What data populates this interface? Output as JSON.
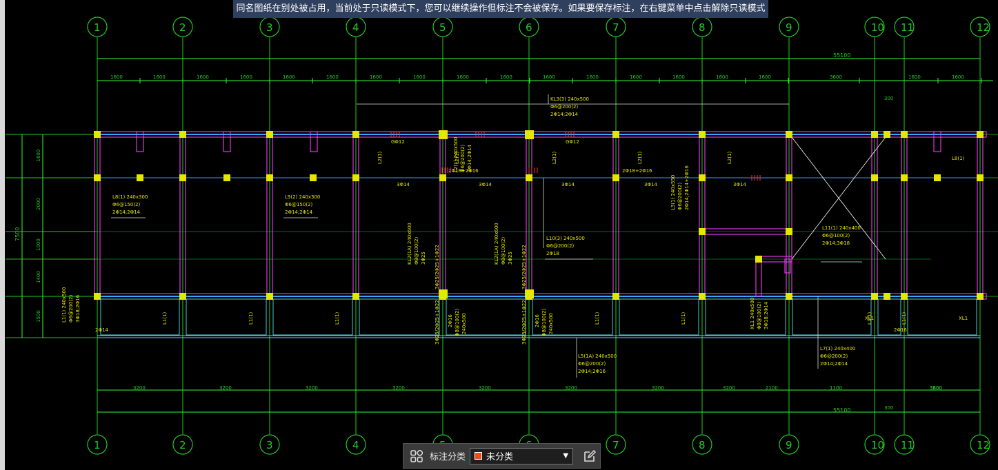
{
  "banner": {
    "text": "同名图纸在别处被占用，当前处于只读模式下，您可以继续操作但标注不会被保存。如果要保存标注，在右键菜单中点击解除只读模式"
  },
  "axes": {
    "labels": [
      "1",
      "2",
      "3",
      "4",
      "5",
      "6",
      "7",
      "8",
      "9",
      "10",
      "11",
      "12"
    ]
  },
  "dimensions": {
    "top_total": "55100",
    "top_segments": [
      "1600",
      "1600",
      "1600",
      "1600",
      "1600",
      "1600",
      "1600",
      "1600",
      "1600",
      "1600",
      "1600",
      "1600",
      "1600",
      "1600",
      "1600",
      "1600",
      "3600",
      "1600",
      "1600"
    ],
    "bottom_segments": [
      "3200",
      "3200",
      "3200",
      "3200",
      "3200",
      "3200",
      "3200",
      "3200",
      "2100",
      "1100",
      "3600",
      "3200"
    ],
    "bottom_total": "55100",
    "gap_top": "300",
    "gap_bottom": "300",
    "left_total": "7500",
    "left_segments": [
      "1600",
      "2000",
      "1000",
      "1400",
      "1500"
    ]
  },
  "beam_labels": [
    {
      "lines": [
        "KL3(3) 240x500",
        "Φ6@200(2)",
        "2Φ14;2Φ14"
      ]
    },
    {
      "lines": [
        "L8(1) 240x300",
        "Φ6@150(2)",
        "2Φ14;2Φ14"
      ]
    },
    {
      "lines": [
        "L9(2) 240x300",
        "Φ6@150(2)",
        "2Φ14;2Φ14"
      ]
    },
    {
      "lines": [
        "L10(3) 240x500",
        "Φ6@200(2)",
        "2Φ18"
      ]
    },
    {
      "lines": [
        "L11(1) 240x400",
        "Φ6@100(2)",
        "2Φ14;3Φ18"
      ]
    },
    {
      "lines": [
        "L5(1A) 240x500",
        "Φ6@200(2)",
        "2Φ14;2Φ16"
      ]
    },
    {
      "lines": [
        "L7(1) 240x400",
        "Φ6@200(2)",
        "2Φ14;2Φ14"
      ]
    },
    {
      "lines": [
        "L1(1)",
        "L1(1)",
        "L1(1)",
        "L1(1)",
        "L1(1)",
        "L1(1)",
        "L1(1)"
      ]
    },
    {
      "lines": [
        "L2(1)",
        "L2(1)",
        "L2(1)",
        "L2(1)",
        "L2(1)"
      ]
    },
    {
      "lines": [
        "GΦ12",
        "GΦ12",
        "3Φ14",
        "3Φ14",
        "3Φ14",
        "3Φ14",
        "3Φ14",
        "2Φ18+2Φ16",
        "2Φ18+2Φ16",
        "2Φ14",
        "2Φ16",
        "XL1",
        "XL1",
        "L8(1)"
      ]
    },
    {
      "lines": [
        "KL2(1A) 240x600",
        "Φ8@100(2)",
        "3Φ25",
        "3Φ25/2Φ25+1Φ22",
        "2Φ16",
        "Φ8@100(2)",
        "240x500"
      ]
    },
    {
      "lines": [
        "L2(1) 240x500",
        "Φ6@200(2)",
        "2Φ14;2Φ14",
        "L3(1) 240x550",
        "Φ6@200(2)",
        "2Φ14;2Φ14+2Φ16",
        "L1(1) 240x500",
        "Φ6@200(2)",
        "3Φ18;2Φ16",
        "XL1 240x500",
        "Φ8@100(2)",
        "3Φ18;2Φ14"
      ]
    }
  ],
  "toolbar": {
    "grid_icon": "grid-icon",
    "label": "标注分类",
    "select_value": "未分类",
    "swatch_color": "#e8501a",
    "edit_icon": "edit-icon"
  },
  "colors": {
    "axis": "#22cc22",
    "beam": "#ff33ff",
    "column": "#e6e600",
    "text": "#e6e600",
    "wall": "#33aaff",
    "dim": "#33ff33"
  }
}
